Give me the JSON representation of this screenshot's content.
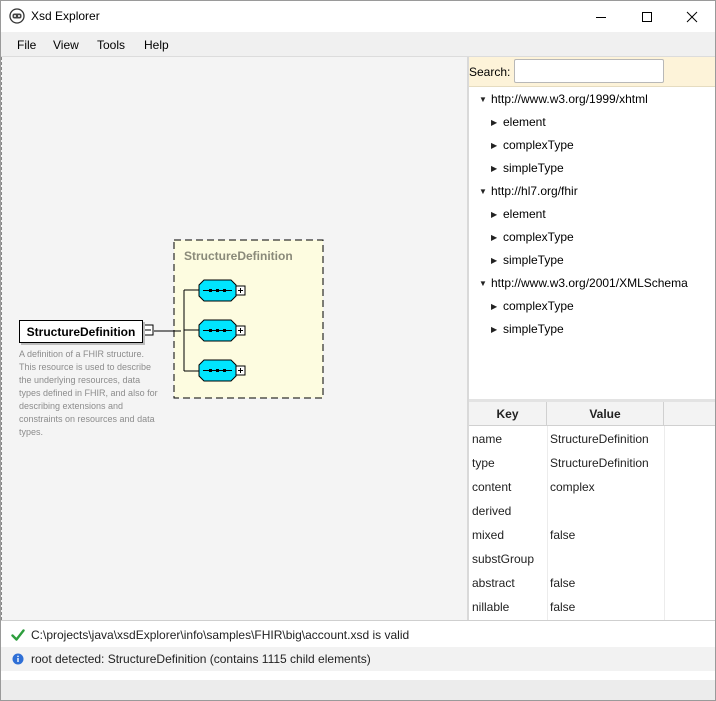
{
  "window": {
    "title": "Xsd Explorer"
  },
  "menu": {
    "items": [
      "File",
      "View",
      "Tools",
      "Help"
    ]
  },
  "diagram": {
    "root_element": "StructureDefinition",
    "root_description": "A definition of a FHIR structure. This resource is used to describe the underlying resources, data types defined in FHIR, and also for describing extensions and constraints on resources and data types.",
    "sequence_title": "StructureDefinition"
  },
  "search": {
    "label": "Search:",
    "value": "",
    "placeholder": ""
  },
  "tree": {
    "namespaces": [
      {
        "label": "http://www.w3.org/1999/xhtml",
        "children": [
          "element",
          "complexType",
          "simpleType"
        ]
      },
      {
        "label": "http://hl7.org/fhir",
        "children": [
          "element",
          "complexType",
          "simpleType"
        ]
      },
      {
        "label": "http://www.w3.org/2001/XMLSchema",
        "children": [
          "complexType",
          "simpleType"
        ]
      }
    ]
  },
  "properties": {
    "headers": {
      "key": "Key",
      "value": "Value"
    },
    "rows": [
      {
        "key": "name",
        "value": "StructureDefinition"
      },
      {
        "key": "type",
        "value": "StructureDefinition"
      },
      {
        "key": "content",
        "value": "complex"
      },
      {
        "key": "derived",
        "value": ""
      },
      {
        "key": "mixed",
        "value": "false"
      },
      {
        "key": "substGroup",
        "value": ""
      },
      {
        "key": "abstract",
        "value": "false"
      },
      {
        "key": "nillable",
        "value": "false"
      }
    ]
  },
  "status": {
    "messages": [
      {
        "icon": "check-icon",
        "text": "C:\\projects\\java\\xsdExplorer\\info\\samples\\FHIR\\big\\account.xsd is valid"
      },
      {
        "icon": "info-icon",
        "text": "root detected: StructureDefinition (contains 1115 child elements)"
      }
    ]
  },
  "colors": {
    "sequence_fill": "#fdfce0",
    "node_fill": "#00e5ff",
    "search_bar": "#fdf3d9",
    "valid_green": "#2e9e3e",
    "info_blue": "#2f6fd6"
  }
}
